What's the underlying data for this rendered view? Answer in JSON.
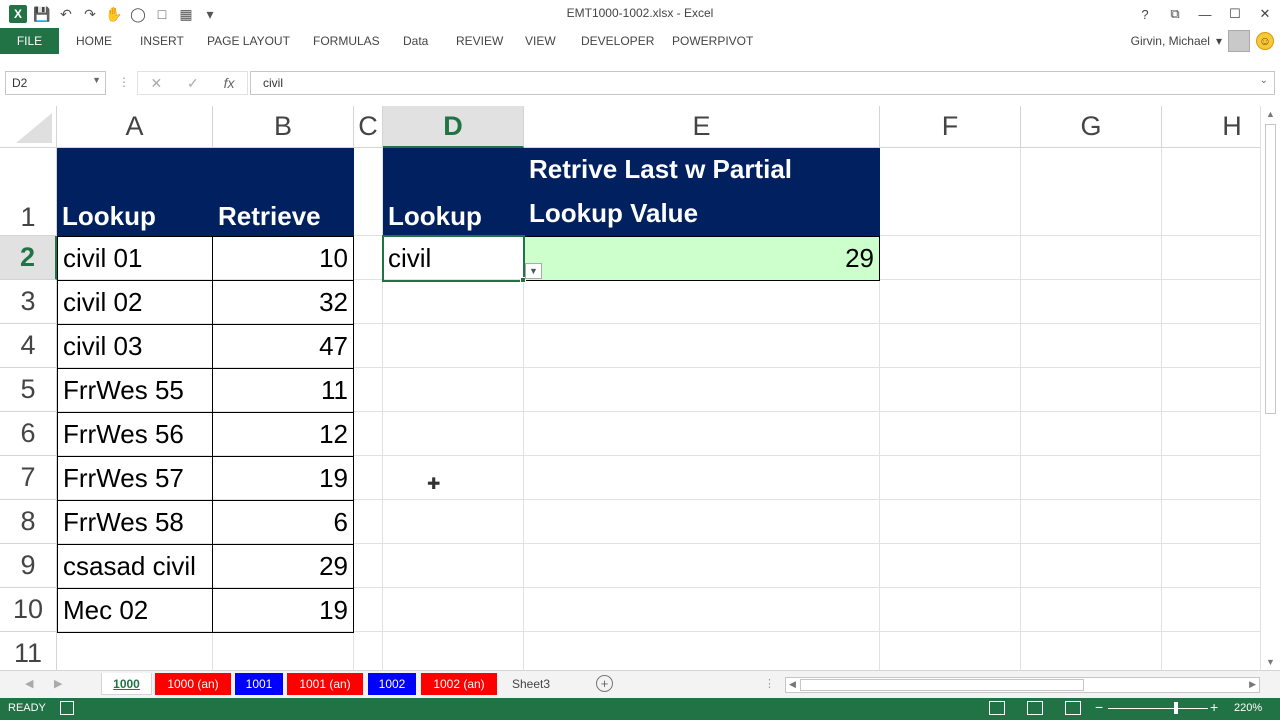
{
  "window": {
    "title": "EMT1000-1002.xlsx - Excel",
    "qat_icons": [
      "excel-logo",
      "save-icon",
      "undo-icon",
      "redo-icon",
      "touch-mode-icon",
      "circle-icon",
      "comment-icon",
      "grid-icon",
      "customize-qat-icon"
    ],
    "help": "?",
    "restore": "⧉",
    "minimize": "—",
    "maximize": "☐",
    "close": "✕"
  },
  "ribbon": {
    "tabs": [
      "FILE",
      "HOME",
      "INSERT",
      "PAGE LAYOUT",
      "FORMULAS",
      "Data",
      "REVIEW",
      "VIEW",
      "DEVELOPER",
      "POWERPIVOT"
    ],
    "user": "Girvin, Michael",
    "user_caret": "▾"
  },
  "formula_bar": {
    "name_box": "D2",
    "cancel": "✕",
    "enter": "✓",
    "fx": "fx",
    "content": "civil"
  },
  "columns": [
    "A",
    "B",
    "C",
    "D",
    "E",
    "F",
    "G",
    "H"
  ],
  "selected_column": "D",
  "rows": [
    "1",
    "2",
    "3",
    "4",
    "5",
    "6",
    "7",
    "8",
    "9",
    "10",
    "11"
  ],
  "selected_row": "2",
  "table1": {
    "header": [
      "Lookup",
      "Retrieve"
    ],
    "rows": [
      [
        "civil 01",
        "10"
      ],
      [
        "civil 02",
        "32"
      ],
      [
        "civil 03",
        "47"
      ],
      [
        "FrrWes 55",
        "11"
      ],
      [
        "FrrWes 56",
        "12"
      ],
      [
        "FrrWes 57",
        "19"
      ],
      [
        "FrrWes 58",
        "6"
      ],
      [
        "csasad civil",
        "29"
      ],
      [
        "Mec 02",
        "19"
      ]
    ]
  },
  "table2": {
    "lookup_header": "Lookup",
    "result_header_line1": "Retrive Last w Partial",
    "result_header_line2": "Lookup Value",
    "lookup_value": "civil",
    "result_value": "29"
  },
  "sheet_tabs": [
    {
      "label": "1000",
      "color": "active"
    },
    {
      "label": "1000 (an)",
      "color": "red"
    },
    {
      "label": "1001",
      "color": "blue"
    },
    {
      "label": "1001 (an)",
      "color": "red"
    },
    {
      "label": "1002",
      "color": "blue"
    },
    {
      "label": "1002 (an)",
      "color": "red"
    },
    {
      "label": "Sheet3",
      "color": "plain"
    }
  ],
  "status": {
    "ready": "READY",
    "zoom": "220%",
    "zoom_minus": "−",
    "zoom_plus": "+"
  },
  "colors": {
    "excel_green": "#217346",
    "header_fill": "#002060",
    "result_fill": "#ccffcc",
    "tab_red": "#ff0000",
    "tab_blue": "#0000ff"
  }
}
